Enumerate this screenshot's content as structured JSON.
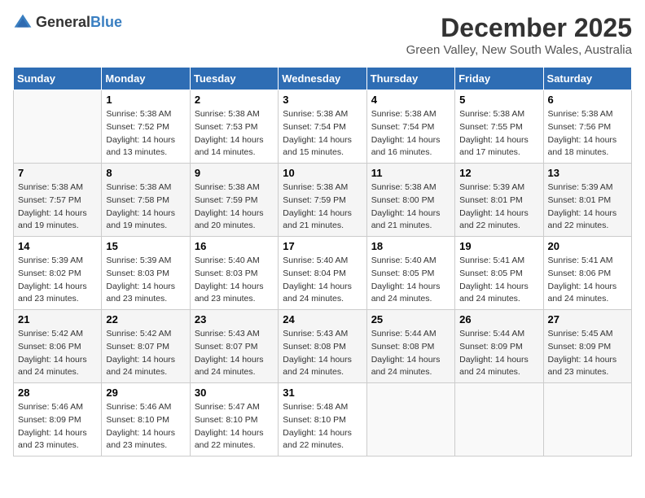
{
  "logo": {
    "text_general": "General",
    "text_blue": "Blue"
  },
  "title": "December 2025",
  "location": "Green Valley, New South Wales, Australia",
  "days_of_week": [
    "Sunday",
    "Monday",
    "Tuesday",
    "Wednesday",
    "Thursday",
    "Friday",
    "Saturday"
  ],
  "weeks": [
    [
      {
        "day": "",
        "sunrise": "",
        "sunset": "",
        "daylight": ""
      },
      {
        "day": "1",
        "sunrise": "Sunrise: 5:38 AM",
        "sunset": "Sunset: 7:52 PM",
        "daylight": "Daylight: 14 hours and 13 minutes."
      },
      {
        "day": "2",
        "sunrise": "Sunrise: 5:38 AM",
        "sunset": "Sunset: 7:53 PM",
        "daylight": "Daylight: 14 hours and 14 minutes."
      },
      {
        "day": "3",
        "sunrise": "Sunrise: 5:38 AM",
        "sunset": "Sunset: 7:54 PM",
        "daylight": "Daylight: 14 hours and 15 minutes."
      },
      {
        "day": "4",
        "sunrise": "Sunrise: 5:38 AM",
        "sunset": "Sunset: 7:54 PM",
        "daylight": "Daylight: 14 hours and 16 minutes."
      },
      {
        "day": "5",
        "sunrise": "Sunrise: 5:38 AM",
        "sunset": "Sunset: 7:55 PM",
        "daylight": "Daylight: 14 hours and 17 minutes."
      },
      {
        "day": "6",
        "sunrise": "Sunrise: 5:38 AM",
        "sunset": "Sunset: 7:56 PM",
        "daylight": "Daylight: 14 hours and 18 minutes."
      }
    ],
    [
      {
        "day": "7",
        "sunrise": "Sunrise: 5:38 AM",
        "sunset": "Sunset: 7:57 PM",
        "daylight": "Daylight: 14 hours and 19 minutes."
      },
      {
        "day": "8",
        "sunrise": "Sunrise: 5:38 AM",
        "sunset": "Sunset: 7:58 PM",
        "daylight": "Daylight: 14 hours and 19 minutes."
      },
      {
        "day": "9",
        "sunrise": "Sunrise: 5:38 AM",
        "sunset": "Sunset: 7:59 PM",
        "daylight": "Daylight: 14 hours and 20 minutes."
      },
      {
        "day": "10",
        "sunrise": "Sunrise: 5:38 AM",
        "sunset": "Sunset: 7:59 PM",
        "daylight": "Daylight: 14 hours and 21 minutes."
      },
      {
        "day": "11",
        "sunrise": "Sunrise: 5:38 AM",
        "sunset": "Sunset: 8:00 PM",
        "daylight": "Daylight: 14 hours and 21 minutes."
      },
      {
        "day": "12",
        "sunrise": "Sunrise: 5:39 AM",
        "sunset": "Sunset: 8:01 PM",
        "daylight": "Daylight: 14 hours and 22 minutes."
      },
      {
        "day": "13",
        "sunrise": "Sunrise: 5:39 AM",
        "sunset": "Sunset: 8:01 PM",
        "daylight": "Daylight: 14 hours and 22 minutes."
      }
    ],
    [
      {
        "day": "14",
        "sunrise": "Sunrise: 5:39 AM",
        "sunset": "Sunset: 8:02 PM",
        "daylight": "Daylight: 14 hours and 23 minutes."
      },
      {
        "day": "15",
        "sunrise": "Sunrise: 5:39 AM",
        "sunset": "Sunset: 8:03 PM",
        "daylight": "Daylight: 14 hours and 23 minutes."
      },
      {
        "day": "16",
        "sunrise": "Sunrise: 5:40 AM",
        "sunset": "Sunset: 8:03 PM",
        "daylight": "Daylight: 14 hours and 23 minutes."
      },
      {
        "day": "17",
        "sunrise": "Sunrise: 5:40 AM",
        "sunset": "Sunset: 8:04 PM",
        "daylight": "Daylight: 14 hours and 24 minutes."
      },
      {
        "day": "18",
        "sunrise": "Sunrise: 5:40 AM",
        "sunset": "Sunset: 8:05 PM",
        "daylight": "Daylight: 14 hours and 24 minutes."
      },
      {
        "day": "19",
        "sunrise": "Sunrise: 5:41 AM",
        "sunset": "Sunset: 8:05 PM",
        "daylight": "Daylight: 14 hours and 24 minutes."
      },
      {
        "day": "20",
        "sunrise": "Sunrise: 5:41 AM",
        "sunset": "Sunset: 8:06 PM",
        "daylight": "Daylight: 14 hours and 24 minutes."
      }
    ],
    [
      {
        "day": "21",
        "sunrise": "Sunrise: 5:42 AM",
        "sunset": "Sunset: 8:06 PM",
        "daylight": "Daylight: 14 hours and 24 minutes."
      },
      {
        "day": "22",
        "sunrise": "Sunrise: 5:42 AM",
        "sunset": "Sunset: 8:07 PM",
        "daylight": "Daylight: 14 hours and 24 minutes."
      },
      {
        "day": "23",
        "sunrise": "Sunrise: 5:43 AM",
        "sunset": "Sunset: 8:07 PM",
        "daylight": "Daylight: 14 hours and 24 minutes."
      },
      {
        "day": "24",
        "sunrise": "Sunrise: 5:43 AM",
        "sunset": "Sunset: 8:08 PM",
        "daylight": "Daylight: 14 hours and 24 minutes."
      },
      {
        "day": "25",
        "sunrise": "Sunrise: 5:44 AM",
        "sunset": "Sunset: 8:08 PM",
        "daylight": "Daylight: 14 hours and 24 minutes."
      },
      {
        "day": "26",
        "sunrise": "Sunrise: 5:44 AM",
        "sunset": "Sunset: 8:09 PM",
        "daylight": "Daylight: 14 hours and 24 minutes."
      },
      {
        "day": "27",
        "sunrise": "Sunrise: 5:45 AM",
        "sunset": "Sunset: 8:09 PM",
        "daylight": "Daylight: 14 hours and 23 minutes."
      }
    ],
    [
      {
        "day": "28",
        "sunrise": "Sunrise: 5:46 AM",
        "sunset": "Sunset: 8:09 PM",
        "daylight": "Daylight: 14 hours and 23 minutes."
      },
      {
        "day": "29",
        "sunrise": "Sunrise: 5:46 AM",
        "sunset": "Sunset: 8:10 PM",
        "daylight": "Daylight: 14 hours and 23 minutes."
      },
      {
        "day": "30",
        "sunrise": "Sunrise: 5:47 AM",
        "sunset": "Sunset: 8:10 PM",
        "daylight": "Daylight: 14 hours and 22 minutes."
      },
      {
        "day": "31",
        "sunrise": "Sunrise: 5:48 AM",
        "sunset": "Sunset: 8:10 PM",
        "daylight": "Daylight: 14 hours and 22 minutes."
      },
      {
        "day": "",
        "sunrise": "",
        "sunset": "",
        "daylight": ""
      },
      {
        "day": "",
        "sunrise": "",
        "sunset": "",
        "daylight": ""
      },
      {
        "day": "",
        "sunrise": "",
        "sunset": "",
        "daylight": ""
      }
    ]
  ]
}
